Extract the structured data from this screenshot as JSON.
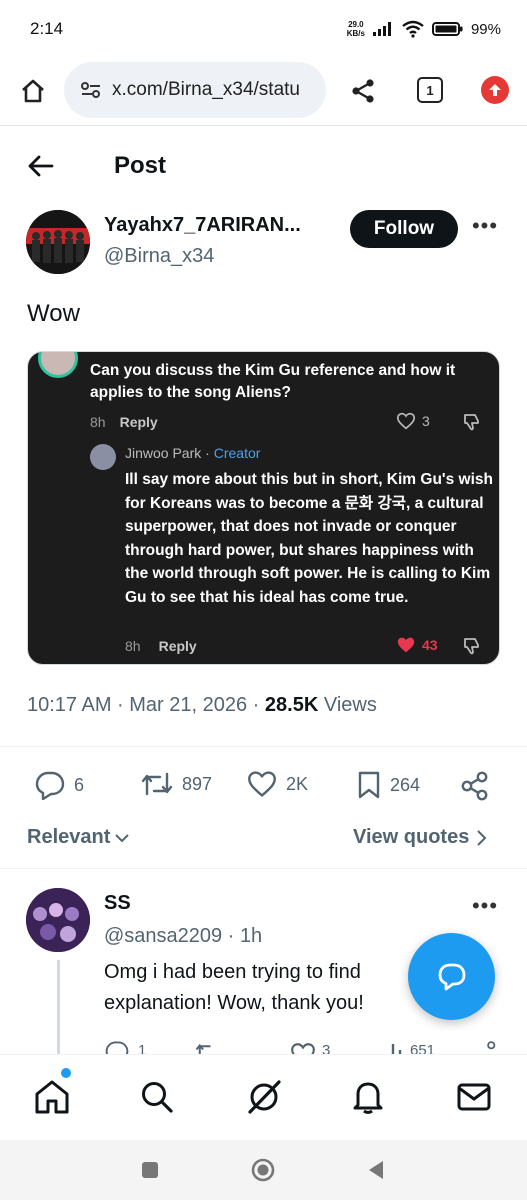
{
  "status_bar": {
    "time": "2:14",
    "net_speed_value": "29.0",
    "net_speed_unit": "KB/s",
    "battery": "99%"
  },
  "browser": {
    "url": "x.com/Birna_x34/statu",
    "tab_count": "1"
  },
  "header": {
    "title": "Post"
  },
  "post": {
    "author_name": "Yayahx7_7ARIRAN...",
    "author_handle": "@Birna_x34",
    "follow_label": "Follow",
    "more": "•••",
    "text": "Wow",
    "timestamp": "10:17 AM · Mar 21, 2026 · ",
    "views_count": "28.5K",
    "views_label": " Views"
  },
  "media": {
    "question": "Can you discuss the Kim Gu reference and how it applies to the song Aliens?",
    "q_age": "8h",
    "q_reply": "Reply",
    "q_likes": "3",
    "replier_name": "Jinwoo Park",
    "replier_sep": " · ",
    "replier_badge": "Creator",
    "reply_text": "Ill say more about this but in short, Kim Gu's wish for Koreans was to become a 문화 강국, a cultural superpower, that does not invade or conquer through hard power, but shares happiness with the world through soft power. He is calling to Kim Gu to see that his ideal has come true.",
    "r_age": "8h",
    "r_reply": "Reply",
    "r_likes": "43"
  },
  "actions": {
    "replies": "6",
    "reposts": "897",
    "likes": "2K",
    "bookmarks": "264"
  },
  "sort": {
    "relevant": "Relevant",
    "view_quotes": "View quotes"
  },
  "reply": {
    "name": "SS",
    "handle": "@sansa2209 · 1h",
    "more": "•••",
    "text": "Omg i had been trying to find explanation! Wow, thank you!",
    "partial_counts": [
      "1",
      "3",
      "651"
    ]
  },
  "colors": {
    "accent": "#1d9bf0",
    "text_primary": "#0f1419",
    "text_secondary": "#536471",
    "card_bg": "#1c1c1c",
    "like_red": "#e8384f",
    "creator_blue": "#4ea1e8"
  }
}
